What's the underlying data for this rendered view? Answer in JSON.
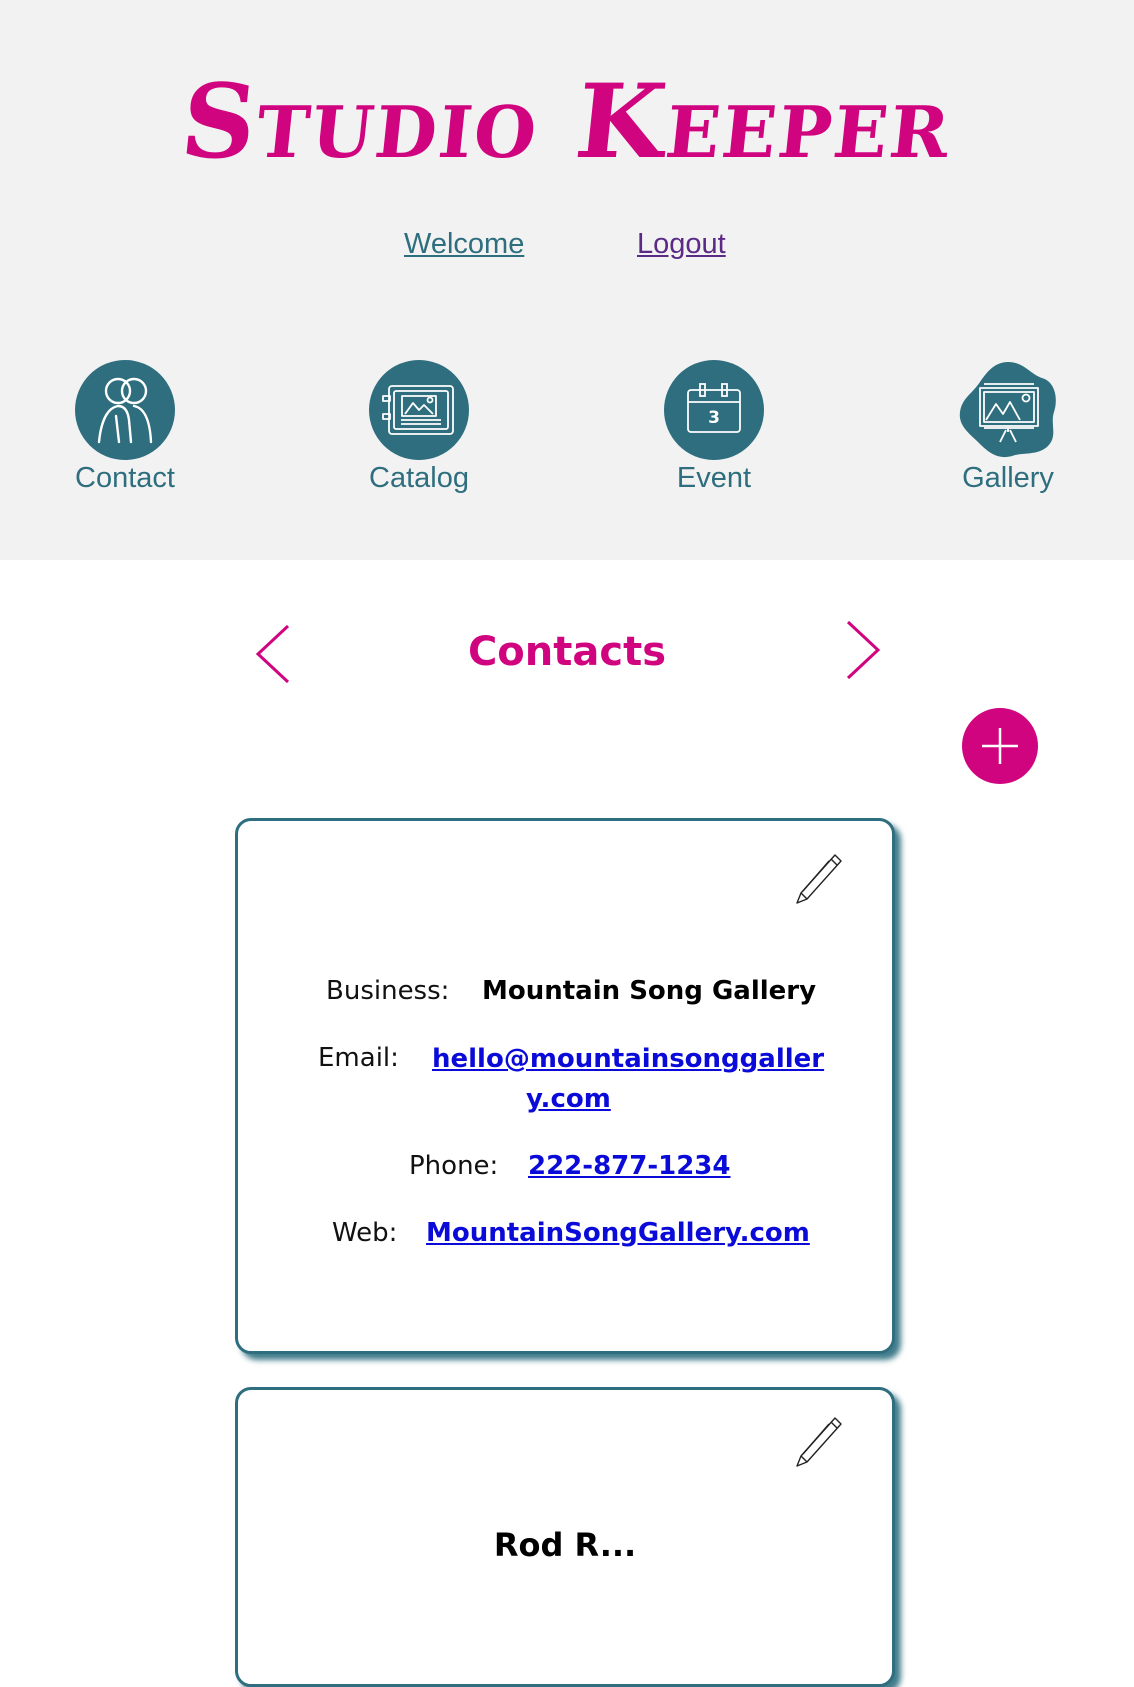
{
  "app": {
    "title": "Studio Keeper"
  },
  "top_links": {
    "welcome": "Welcome",
    "logout": "Logout"
  },
  "nav": {
    "items": [
      {
        "label": "Contact",
        "icon": "people-icon"
      },
      {
        "label": "Catalog",
        "icon": "catalog-icon"
      },
      {
        "label": "Event",
        "icon": "calendar-icon",
        "day": "3"
      },
      {
        "label": "Gallery",
        "icon": "easel-icon"
      }
    ]
  },
  "section": {
    "title": "Contacts"
  },
  "colors": {
    "brand": "#d0047f",
    "teal": "#2e6e7e",
    "header_bg": "#f2f2f2",
    "link": "#0b0bd9"
  },
  "cards": [
    {
      "business_label": "Business:",
      "business_value": "Mountain Song Gallery",
      "email_label": "Email:",
      "email_value_line1": "hello@mountainsonggaller",
      "email_value_line2": "y.com",
      "phone_label": "Phone:",
      "phone_value": "222-877-1234",
      "web_label": "Web:",
      "web_value": "MountainSongGallery.com"
    },
    {
      "title": "Rod R..."
    }
  ]
}
